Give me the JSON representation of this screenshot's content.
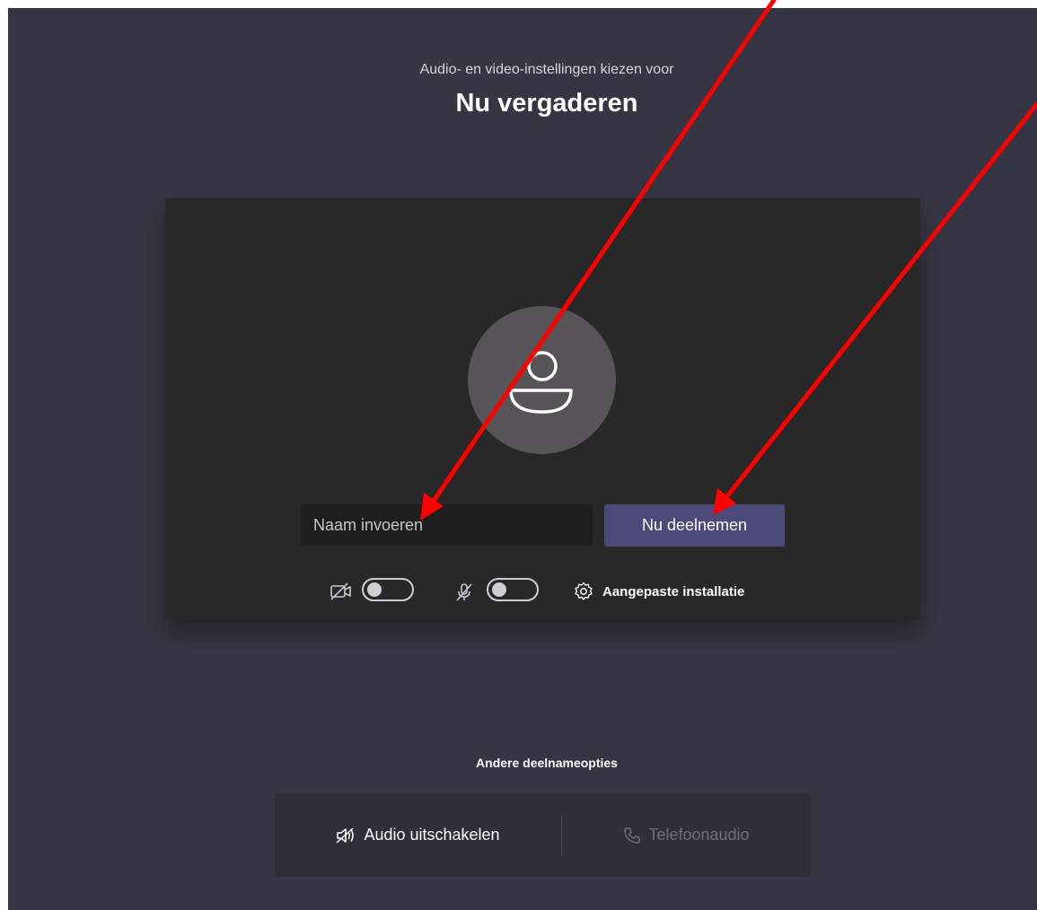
{
  "header": {
    "subtitle": "Audio- en video-instellingen kiezen voor",
    "title": "Nu vergaderen"
  },
  "preview": {
    "avatar_icon": "person-icon",
    "name_input": {
      "value": "",
      "placeholder": "Naam invoeren"
    },
    "join_button_label": "Nu deelnemen",
    "video_toggle": {
      "icon": "camera-off-icon",
      "on": false
    },
    "mic_toggle": {
      "icon": "mic-off-icon",
      "on": false
    },
    "settings": {
      "icon": "gear-icon",
      "label": "Aangepaste installatie"
    }
  },
  "other_options": {
    "label": "Andere deelnameopties",
    "audio_off": {
      "icon": "speaker-off-icon",
      "label": "Audio uitschakelen"
    },
    "phone_audio": {
      "icon": "phone-icon",
      "label": "Telefoonaudio",
      "enabled": false
    }
  },
  "colors": {
    "background": "#363543",
    "preview_panel": "#292829",
    "join_button": "#4b4a79",
    "annotation_arrow": "#ff0000"
  }
}
